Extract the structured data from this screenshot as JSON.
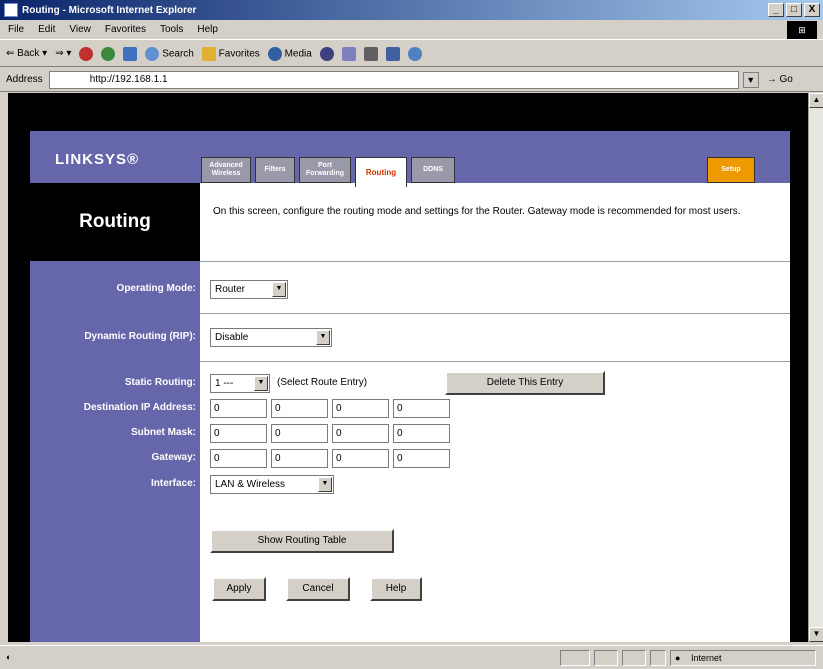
{
  "window": {
    "title": "Routing - Microsoft Internet Explorer",
    "controls": [
      "_",
      "□",
      "X"
    ]
  },
  "menu": {
    "items": [
      "File",
      "Edit",
      "View",
      "Favorites",
      "Tools",
      "Help"
    ]
  },
  "toolbar": {
    "back": "Back",
    "search": "Search",
    "favorites": "Favorites",
    "media": "Media"
  },
  "address": {
    "label": "Address",
    "url": "http://192.168.1.1",
    "go": "Go"
  },
  "brand": {
    "logo": "LINKSYS®"
  },
  "tabs": [
    {
      "label": "Advanced Wireless"
    },
    {
      "label": "Filters"
    },
    {
      "label": "Port Forwarding"
    },
    {
      "label": "Routing"
    },
    {
      "label": "DDNS"
    },
    {
      "label": "Setup"
    }
  ],
  "page": {
    "title": "Routing",
    "description": "On this screen, configure the routing mode and settings for the Router. Gateway mode is recommended for most users."
  },
  "form": {
    "operating_mode": {
      "label": "Operating Mode:",
      "value": "Router"
    },
    "dynamic_routing": {
      "label": "Dynamic Routing (RIP):",
      "value": "Disable"
    },
    "static_routing": {
      "label": "Static Routing:",
      "value": "1 ---",
      "hint": "(Select Route Entry)",
      "delete_button": "Delete This Entry"
    },
    "dest_ip": {
      "label": "Destination IP Address:",
      "octets": [
        "0",
        "0",
        "0",
        "0"
      ]
    },
    "subnet_mask": {
      "label": "Subnet Mask:",
      "octets": [
        "0",
        "0",
        "0",
        "0"
      ]
    },
    "gateway": {
      "label": "Gateway:",
      "octets": [
        "0",
        "0",
        "0",
        "0"
      ]
    },
    "interface": {
      "label": "Interface:",
      "value": "LAN & Wireless"
    },
    "show_table_button": "Show Routing Table",
    "apply_button": "Apply",
    "cancel_button": "Cancel",
    "help_button": "Help"
  },
  "status": {
    "zone": "Internet"
  }
}
